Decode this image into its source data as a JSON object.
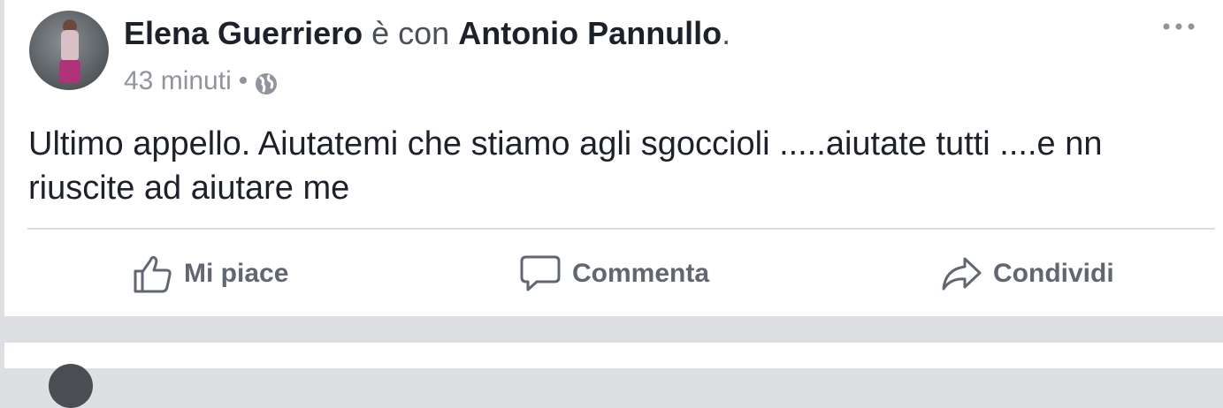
{
  "post": {
    "author": "Elena Guerriero",
    "with_text": "è con",
    "tagged": "Antonio Pannullo",
    "period": ".",
    "time": "43 minuti",
    "separator": "•",
    "privacy_icon": "globe-icon",
    "menu_icon": "more-options-icon",
    "body": "Ultimo appello. Aiutatemi che stiamo agli sgoccioli .....aiutate tutti ....e nn riuscite ad aiutare me"
  },
  "actions": {
    "like_label": "Mi piace",
    "comment_label": "Commenta",
    "share_label": "Condividi"
  },
  "colors": {
    "feed_background": "#dddfe2",
    "card_background": "#ffffff",
    "primary_text": "#1d2129",
    "secondary_text": "#90949c",
    "action_text": "#616770"
  }
}
